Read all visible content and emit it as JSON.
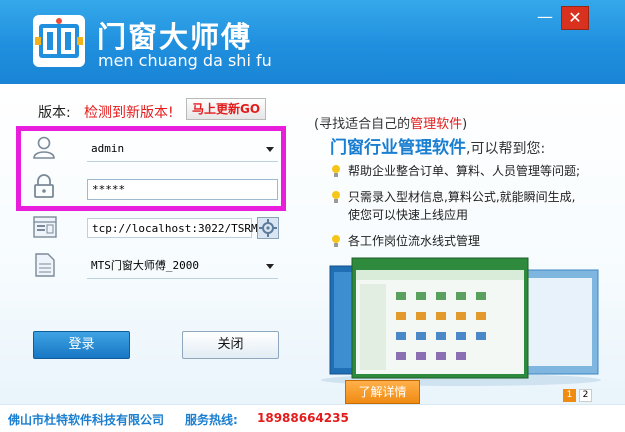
{
  "header": {
    "title": "门窗大师傅",
    "subtitle": "men chuang da shi fu",
    "minimize_label": "—",
    "close_label": "✕"
  },
  "version": {
    "label": "版本:",
    "status": "检测到新版本!",
    "update_button": "马上更新GO"
  },
  "login": {
    "username": "admin",
    "password": "*****",
    "server": "tcp://localhost:3022/TSRMT.",
    "account_set": "MTS门窗大师傅_2000",
    "login_button": "登录",
    "close_button": "关闭"
  },
  "promo": {
    "tagline_prefix": "(寻找适合自己的",
    "tagline_highlight": "管理软件",
    "tagline_suffix": ")",
    "headline": "门窗行业管理软件",
    "headline_rest": ",可以帮到您:",
    "features": [
      "帮助企业整合订单、算料、人员管理等问题;",
      "只需录入型材信息,算料公式,就能瞬间生成,",
      "使您可以快速上线应用",
      "各工作岗位流水线式管理"
    ],
    "details_button": "了解详情",
    "pages": [
      "1",
      "2"
    ]
  },
  "footer": {
    "company": "佛山市杜特软件科技有限公司",
    "hotline_label": "服务热线:",
    "hotline_number": "18988664235"
  },
  "colors": {
    "header_blue": "#1f8fde",
    "highlight_magenta": "#e81edc",
    "alert_red": "#e41b1b",
    "accent_orange": "#f08b12"
  }
}
